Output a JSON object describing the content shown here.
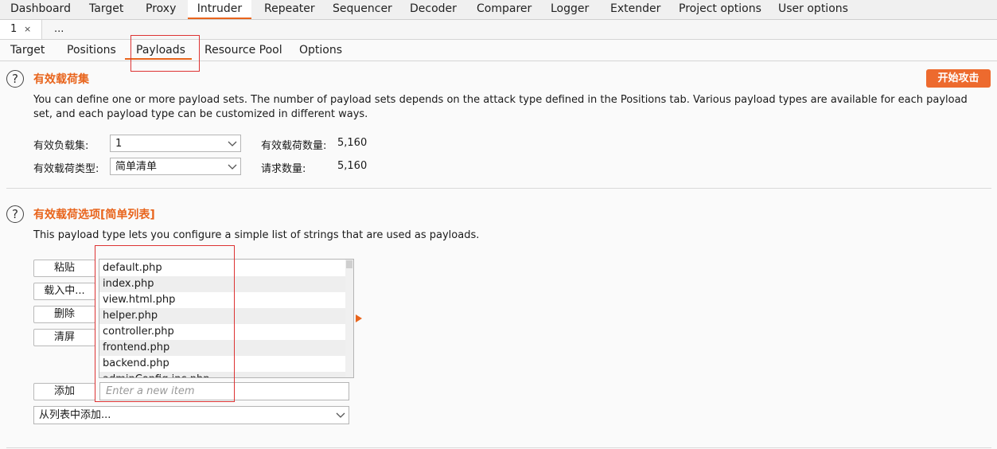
{
  "main_tabs": [
    "Dashboard",
    "Target",
    "Proxy",
    "Intruder",
    "Repeater",
    "Sequencer",
    "Decoder",
    "Comparer",
    "Logger",
    "Extender",
    "Project options",
    "User options"
  ],
  "active_main_tab": "Intruder",
  "sub_tabs": {
    "first": "1",
    "close": "×",
    "more": "..."
  },
  "intruder_tabs": [
    "Target",
    "Positions",
    "Payloads",
    "Resource Pool",
    "Options"
  ],
  "active_intruder_tab": "Payloads",
  "start_attack": "开始攻击",
  "payload_sets": {
    "heading": "有效载荷集",
    "description": "You can define one or more payload sets. The number of payload sets depends on the attack type defined in the Positions tab. Various payload types are available for each payload set, and each payload type can be customized in different ways.",
    "set_label": "有效负载集:",
    "set_value": "1",
    "type_label": "有效载荷类型:",
    "type_value": "简单清单",
    "count_label": "有效载荷数量:",
    "count_value": "5,160",
    "request_label": "请求数量:",
    "request_value": "5,160"
  },
  "payload_options": {
    "heading": "有效载荷选项[简单列表]",
    "description": "This payload type lets you configure a simple list of strings that are used as payloads.",
    "buttons": {
      "paste": "粘贴",
      "load": "载入中...",
      "remove": "删除",
      "clear": "清屏",
      "add": "添加"
    },
    "items": [
      "default.php",
      "index.php",
      "view.html.php",
      "helper.php",
      "controller.php",
      "frontend.php",
      "backend.php",
      "adminConfig.inc.php"
    ],
    "add_placeholder": "Enter a new item",
    "add_from_list": "从列表中添加..."
  },
  "colors": {
    "accent": "#e8641c",
    "button_orange": "#ed6a2e",
    "highlight_box": "#dd3333"
  }
}
